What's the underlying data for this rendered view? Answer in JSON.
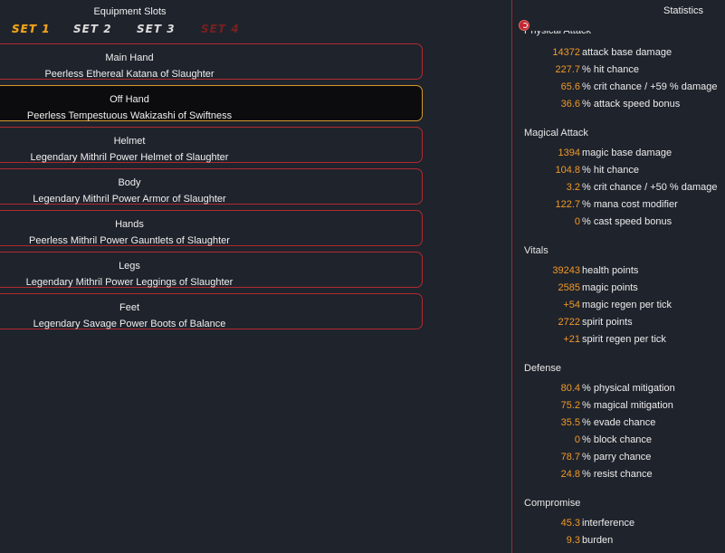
{
  "equipment": {
    "title": "Equipment Slots",
    "sets": [
      "SET 1",
      "SET 2",
      "SET 3",
      "SET 4"
    ],
    "slots": [
      {
        "name": "Main Hand",
        "item": "Peerless Ethereal Katana of Slaughter"
      },
      {
        "name": "Off Hand",
        "item": "Peerless Tempestuous Wakizashi of Swiftness"
      },
      {
        "name": "Helmet",
        "item": "Legendary Mithril Power Helmet of Slaughter"
      },
      {
        "name": "Body",
        "item": "Legendary Mithril Power Armor of Slaughter"
      },
      {
        "name": "Hands",
        "item": "Peerless Mithril Power Gauntlets of Slaughter"
      },
      {
        "name": "Legs",
        "item": "Legendary Mithril Power Leggings of Slaughter"
      },
      {
        "name": "Feet",
        "item": "Legendary Savage Power Boots of Balance"
      }
    ]
  },
  "statistics": {
    "title": "Statistics",
    "physical": {
      "title": "Physical Attack",
      "rows": [
        {
          "value": "14372",
          "label": "attack base damage"
        },
        {
          "value": "227.7",
          "label": "% hit chance"
        },
        {
          "value": "65.6",
          "label": "% crit chance / +59 % damage"
        },
        {
          "value": "36.6",
          "label": "% attack speed bonus"
        }
      ]
    },
    "magical": {
      "title": "Magical Attack",
      "rows": [
        {
          "value": "1394",
          "label": "magic base damage"
        },
        {
          "value": "104.8",
          "label": "% hit chance"
        },
        {
          "value": "3.2",
          "label": "% crit chance / +50 % damage"
        },
        {
          "value": "122.7",
          "label": "% mana cost modifier"
        },
        {
          "value": "0",
          "label": "% cast speed bonus"
        }
      ]
    },
    "vitals": {
      "title": "Vitals",
      "rows": [
        {
          "value": "39243",
          "label": "health points"
        },
        {
          "value": "2585",
          "label": "magic points"
        },
        {
          "value": "+54",
          "label": "magic regen per tick"
        },
        {
          "value": "2722",
          "label": "spirit points"
        },
        {
          "value": "+21",
          "label": "spirit regen per tick"
        }
      ]
    },
    "defense": {
      "title": "Defense",
      "rows": [
        {
          "value": "80.4",
          "label": "% physical mitigation"
        },
        {
          "value": "75.2",
          "label": "% magical mitigation"
        },
        {
          "value": "35.5",
          "label": "% evade chance"
        },
        {
          "value": "0",
          "label": "% block chance"
        },
        {
          "value": "78.7",
          "label": "% parry chance"
        },
        {
          "value": "24.8",
          "label": "% resist chance"
        }
      ]
    },
    "compromise": {
      "title": "Compromise",
      "rows": [
        {
          "value": "45.3",
          "label": "interference"
        },
        {
          "value": "9.3",
          "label": "burden"
        }
      ]
    }
  },
  "colors": {
    "accent": "#f19a27",
    "border": "#b02a30",
    "active_border": "#d69a2a",
    "background": "#1f232c"
  }
}
